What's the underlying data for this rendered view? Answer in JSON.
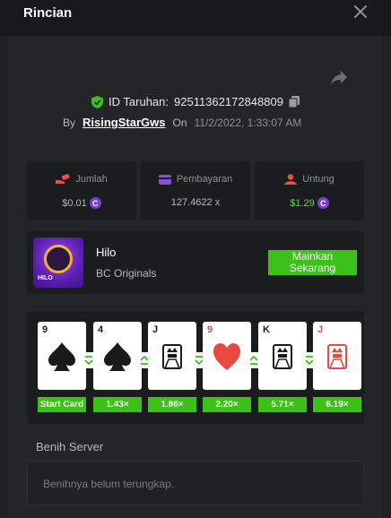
{
  "header": {
    "title": "Rincian"
  },
  "bet": {
    "id_label": "ID Taruhan:",
    "id_value": "92511362172848809",
    "by_label": "By",
    "username": "RisingStarGws",
    "on_label": "On",
    "datetime": "11/2/2022, 1:33:07 AM"
  },
  "stats": {
    "amount": {
      "label": "Jumlah",
      "value": "$0.01"
    },
    "payout": {
      "label": "Pembayaran",
      "value": "127.4622 x"
    },
    "profit": {
      "label": "Untung",
      "value": "$1.29"
    },
    "coin_symbol": "C"
  },
  "game": {
    "name": "Hilo",
    "provider": "BC Originals",
    "thumb_label": "HILO",
    "play_label_1": "Mainkan",
    "play_label_2": "Sekarang"
  },
  "cards": [
    {
      "rank": "9",
      "suit": "spade",
      "color": "#1a1a1a",
      "multiplier": "Start Card",
      "connector": "down"
    },
    {
      "rank": "4",
      "suit": "spade",
      "color": "#1a1a1a",
      "multiplier": "1.43×",
      "connector": "up"
    },
    {
      "rank": "J",
      "suit": "face",
      "color": "#1a1a1a",
      "multiplier": "1.86×",
      "connector": "down"
    },
    {
      "rank": "9",
      "suit": "heart",
      "color": "#e84a3f",
      "multiplier": "2.20×",
      "connector": "up"
    },
    {
      "rank": "K",
      "suit": "face",
      "color": "#1a1a1a",
      "multiplier": "5.71×",
      "connector": "down"
    },
    {
      "rank": "J",
      "suit": "face",
      "color": "#e84a3f",
      "multiplier": "6.19×",
      "connector": ""
    }
  ],
  "seed": {
    "title": "Benih Server",
    "placeholder": "Benihnya belum terungkap."
  },
  "colors": {
    "accent": "#3bc117",
    "profit": "#5bd84a",
    "coin": "#7b3dd9",
    "shield": "#3bc117"
  }
}
